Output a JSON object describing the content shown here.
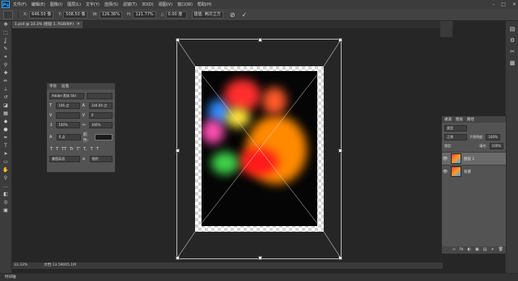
{
  "menubar": {
    "logo": "Ps",
    "items": [
      "文件(F)",
      "编辑(E)",
      "图像(I)",
      "图层(L)",
      "文字(Y)",
      "选择(S)",
      "滤镜(T)",
      "3D(D)",
      "视图(V)",
      "窗口(W)",
      "帮助(H)"
    ],
    "window_controls": [
      "–",
      "□",
      "✕"
    ]
  },
  "options": {
    "x_label": "X:",
    "x_value": "646.50 像",
    "y_label": "Y:",
    "y_value": "508.50 像",
    "w_label": "W:",
    "w_value": "126.36%",
    "h_label": "H:",
    "h_value": "121.77%",
    "angle_label": "△",
    "angle_value": "0.00 度",
    "interp_value": "插值: 两次立方",
    "cancel_icon": "⊘",
    "commit_icon": "✓"
  },
  "document": {
    "tab_title": "1.psd @ 33.3% (图层 1, RGB/8#)",
    "close_icon": "✕"
  },
  "character_panel": {
    "tabs": [
      "字符",
      "段落"
    ],
    "font_family": "Adobe 黑体 Std",
    "font_style": "",
    "font_size": "106 点",
    "leading": "144.04 点",
    "kerning": "",
    "tracking": "0",
    "scale_v": "100%",
    "scale_h": "100%",
    "baseline": "0 点",
    "color_label": "颜色:",
    "styles": [
      "T",
      "T",
      "TT",
      "Tr",
      "T'",
      "T,",
      "T",
      "T"
    ],
    "lang_value": "美国英语",
    "aa_value": "锐利"
  },
  "layers_panel": {
    "tabs": [
      "通道",
      "图层",
      "路径"
    ],
    "kind_label": "类型",
    "blend_mode": "正常",
    "opacity_label": "不透明度:",
    "opacity_value": "100%",
    "lock_label": "锁定:",
    "fill_label": "填充:",
    "fill_value": "100%",
    "layers": [
      {
        "name": "图层 1",
        "selected": true
      },
      {
        "name": "背景",
        "selected": false
      }
    ],
    "footer_icons": [
      "∞",
      "fx",
      "◐",
      "▣",
      "▤",
      "+",
      "🗑"
    ]
  },
  "statusbar": {
    "zoom": "33.33%",
    "doc_info": "文档:13.5M/65.1M"
  },
  "timeline": {
    "label": "时间轴"
  },
  "colors": {
    "accent": "#31a8ff",
    "panel": "#535353",
    "canvas_bg": "#262626"
  }
}
